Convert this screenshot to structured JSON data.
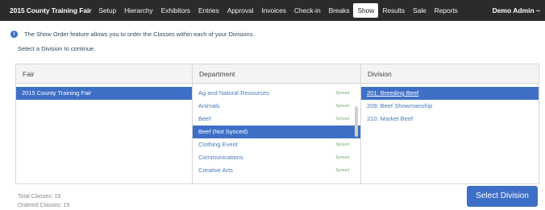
{
  "topbar": {
    "brand": "2015 County Training Fair",
    "nav": [
      "Setup",
      "Hierarchy",
      "Exhibitors",
      "Entries",
      "Approval",
      "Invoices",
      "Check-in",
      "Breaks",
      "Show",
      "Results",
      "Sale",
      "Reports"
    ],
    "active": "Show",
    "user": "Demo Admin ~"
  },
  "info": {
    "line1": "The Show Order feature allows you to order the Classes within each of your Divisions.",
    "line2": "Select a Division to continue."
  },
  "columns": {
    "fair": {
      "header": "Fair",
      "items": [
        {
          "label": "2015 County Training Fair",
          "selected": true
        }
      ]
    },
    "department": {
      "header": "Department",
      "items": [
        {
          "label": "Ag and Natural Resources",
          "status": "Synced"
        },
        {
          "label": "Animals",
          "status": "Synced"
        },
        {
          "label": "Beef",
          "status": "Synced"
        },
        {
          "label": "Beef (Not Synced)",
          "status": "",
          "selected": true
        },
        {
          "label": "Clothing Event",
          "status": "Synced"
        },
        {
          "label": "Communications",
          "status": "Synced"
        },
        {
          "label": "Creative Arts",
          "status": "Synced"
        }
      ]
    },
    "division": {
      "header": "Division",
      "items": [
        {
          "label": "201: Breeding Beef",
          "selected": true
        },
        {
          "label": "209: Beef Showmanship"
        },
        {
          "label": "210: Market Beef"
        }
      ]
    }
  },
  "footer": {
    "total_classes": "Total Classes: 19",
    "ordered_classes": "Ordered Classes: 19",
    "select_button": "Select Division"
  },
  "colors": {
    "accent": "#3d6fc7",
    "topbar": "#2b2b2b",
    "synced": "#6fa86f"
  }
}
